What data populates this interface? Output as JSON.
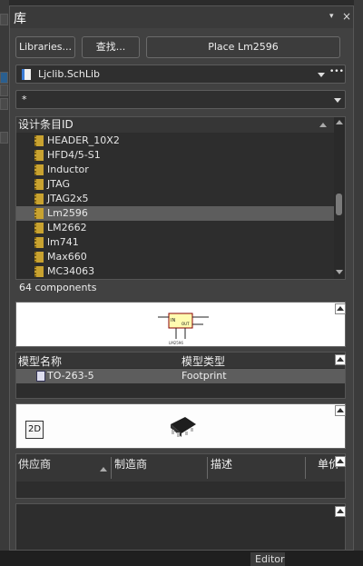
{
  "panel": {
    "title": "库",
    "pin_glyph": "▾",
    "close_glyph": "×"
  },
  "buttons": {
    "libraries": "Libraries...",
    "search": "查找...",
    "place": "Place Lm2596"
  },
  "library_select": {
    "value": "Ljclib.SchLib",
    "more": "•••"
  },
  "filter": {
    "value": "*"
  },
  "component_list": {
    "header": "设计条目ID",
    "items": [
      "HEADER_10X2",
      "HFD4/5-S1",
      "Inductor",
      "JTAG",
      "JTAG2x5",
      "Lm2596",
      "LM2662",
      "lm741",
      "Max660",
      "MC34063"
    ],
    "selected_index": 5,
    "count_text": "64 components"
  },
  "preview": {
    "pin_in": "IN",
    "pin_out": "OUT",
    "part_label": "LM2596"
  },
  "models": {
    "col_name": "模型名称",
    "col_type": "模型类型",
    "rows": [
      {
        "name": "TO-263-5",
        "type": "Footprint"
      }
    ]
  },
  "view3d": {
    "mode_button": "2D"
  },
  "suppliers": {
    "columns": [
      "供应商",
      "制造商",
      "描述",
      "单价"
    ]
  },
  "bottom_tab": {
    "label": "Editor"
  },
  "colors": {
    "panel_bg": "#414141",
    "selection": "#5d5d5d",
    "component_icon": "#c8a230"
  }
}
